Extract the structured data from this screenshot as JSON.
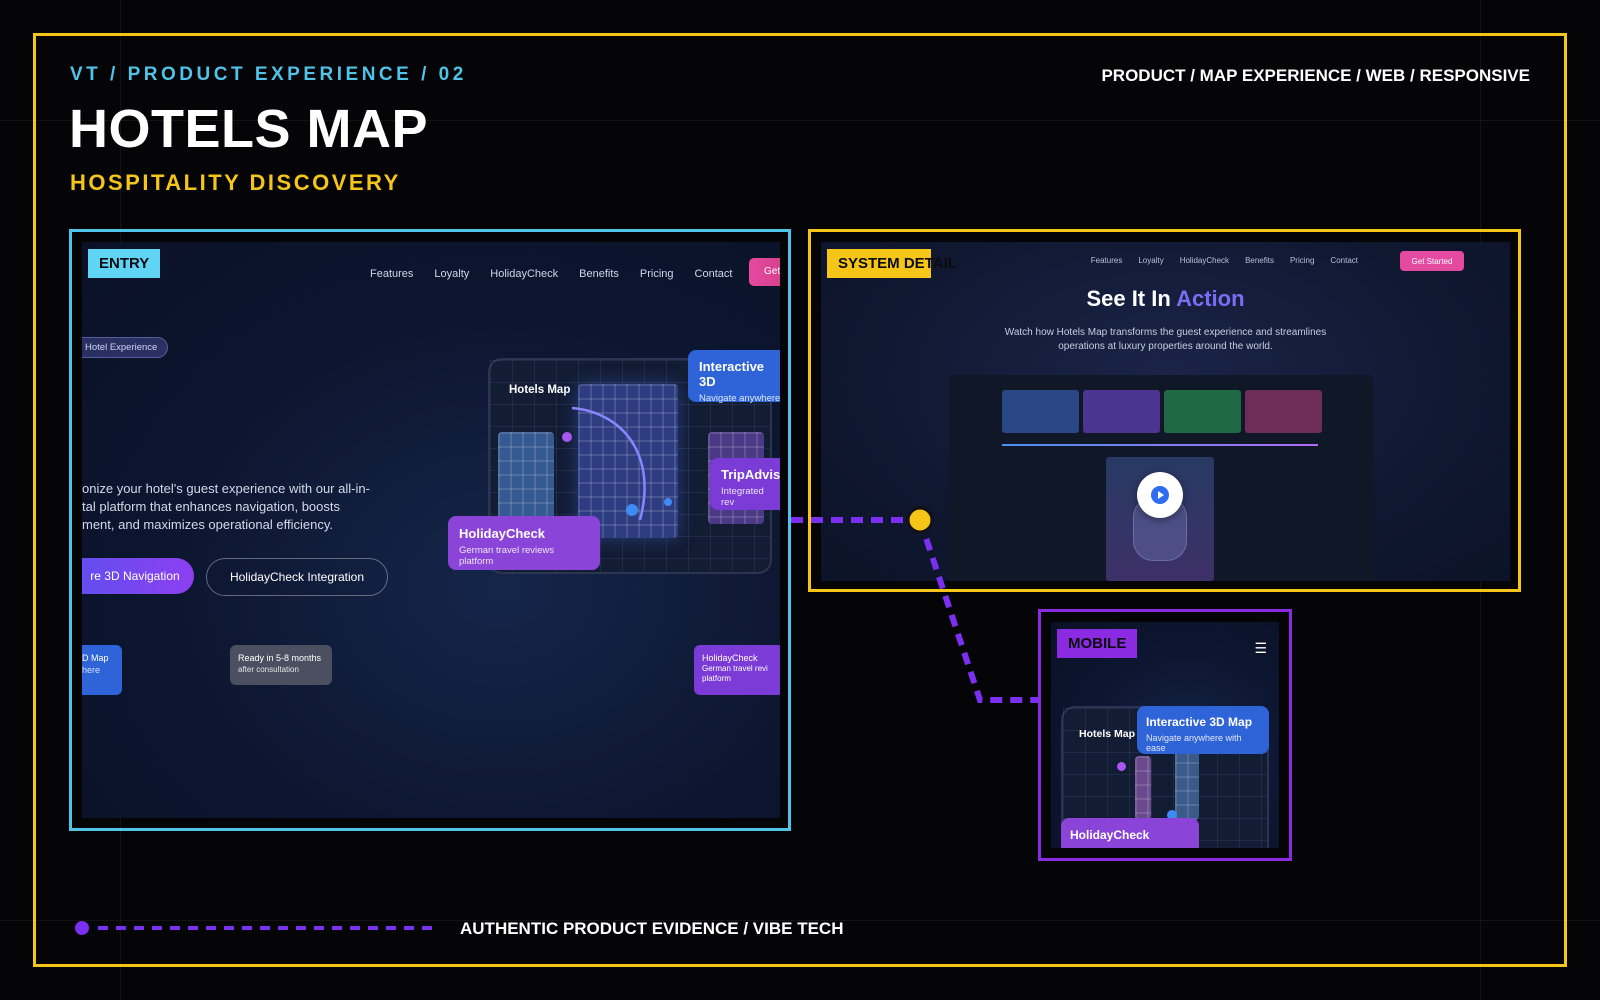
{
  "header": {
    "eyebrow": "VT / PRODUCT EXPERIENCE / 02",
    "meta": "PRODUCT / MAP EXPERIENCE / WEB / RESPONSIVE",
    "title": "HOTELS MAP",
    "subtitle": "HOSPITALITY DISCOVERY"
  },
  "colors": {
    "frame": "#f5c518",
    "entry": "#4fc3e8",
    "mobile": "#8a2be2",
    "connector": "#7b2ff0"
  },
  "entry": {
    "tag": "ENTRY",
    "nav": [
      "Features",
      "Loyalty",
      "HolidayCheck",
      "Benefits",
      "Pricing",
      "Contact"
    ],
    "get_label": "Get",
    "pill": "Hotel Experience",
    "body_lines": [
      "onize your hotel's guest experience with our all-in-",
      "tal platform that enhances navigation, boosts",
      "ment, and maximizes operational efficiency."
    ],
    "btn_primary": "re 3D Navigation",
    "btn_secondary": "HolidayCheck Integration",
    "mini_left": {
      "line1": "D Map",
      "line2": "here"
    },
    "mini_ready": {
      "line1": "Ready in 5-8 months",
      "line2": "after consultation"
    },
    "mini_right": {
      "line1": "HolidayCheck",
      "line2": "German travel revi",
      "line3": "platform"
    },
    "device_label": "Hotels Map",
    "card_interactive": {
      "title": "Interactive 3D",
      "sub": "Navigate anywhere"
    },
    "card_trip": {
      "title": "TripAdvis",
      "sub": "Integrated rev"
    },
    "card_holiday": {
      "title": "HolidayCheck",
      "sub": "German travel reviews platform"
    }
  },
  "system": {
    "tag": "SYSTEM DETAIL",
    "nav": [
      "Features",
      "Loyalty",
      "HolidayCheck",
      "Benefits",
      "Pricing",
      "Contact"
    ],
    "get_label": "Get Started",
    "heading_plain": "See It In ",
    "heading_accent": "Action",
    "desc_line1": "Watch how Hotels Map transforms the guest experience and streamlines",
    "desc_line2": "operations at luxury properties around the world."
  },
  "mobile": {
    "tag": "MOBILE",
    "device_label": "Hotels Map",
    "card_interactive": {
      "title": "Interactive 3D Map",
      "sub": "Navigate anywhere with ease"
    },
    "card_holiday": {
      "title": "HolidayCheck"
    }
  },
  "footer": {
    "label": "AUTHENTIC PRODUCT EVIDENCE / VIBE TECH"
  }
}
